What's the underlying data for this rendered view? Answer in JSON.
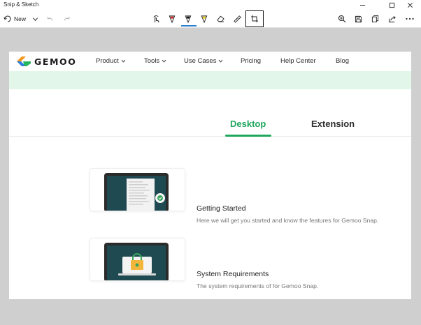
{
  "window": {
    "title": "Snip & Sketch"
  },
  "toolbar": {
    "new_label": "New",
    "tools": [
      "touch-writing",
      "ballpoint-pen",
      "pencil",
      "highlighter",
      "eraser",
      "ruler",
      "image-crop"
    ],
    "right_tools": [
      "zoom",
      "save",
      "copy",
      "share",
      "see-more"
    ]
  },
  "page": {
    "logo_text": "GEMOO",
    "nav": [
      "Product",
      "Tools",
      "Use Cases",
      "Pricing",
      "Help Center",
      "Blog"
    ],
    "tabs": {
      "desktop": "Desktop",
      "extension": "Extension"
    },
    "cards": [
      {
        "title": "Getting Started",
        "description": "Here we will get you started and know the features for Gemoo Snap."
      },
      {
        "title": "System Requirements",
        "description": "The system requirements of for Gemoo Snap."
      }
    ]
  },
  "colors": {
    "brand_green": "#1fa75e",
    "band_green": "#e3f6ea",
    "canvas_gray": "#cfcfcf",
    "accent_blue": "#2a7fd4"
  }
}
